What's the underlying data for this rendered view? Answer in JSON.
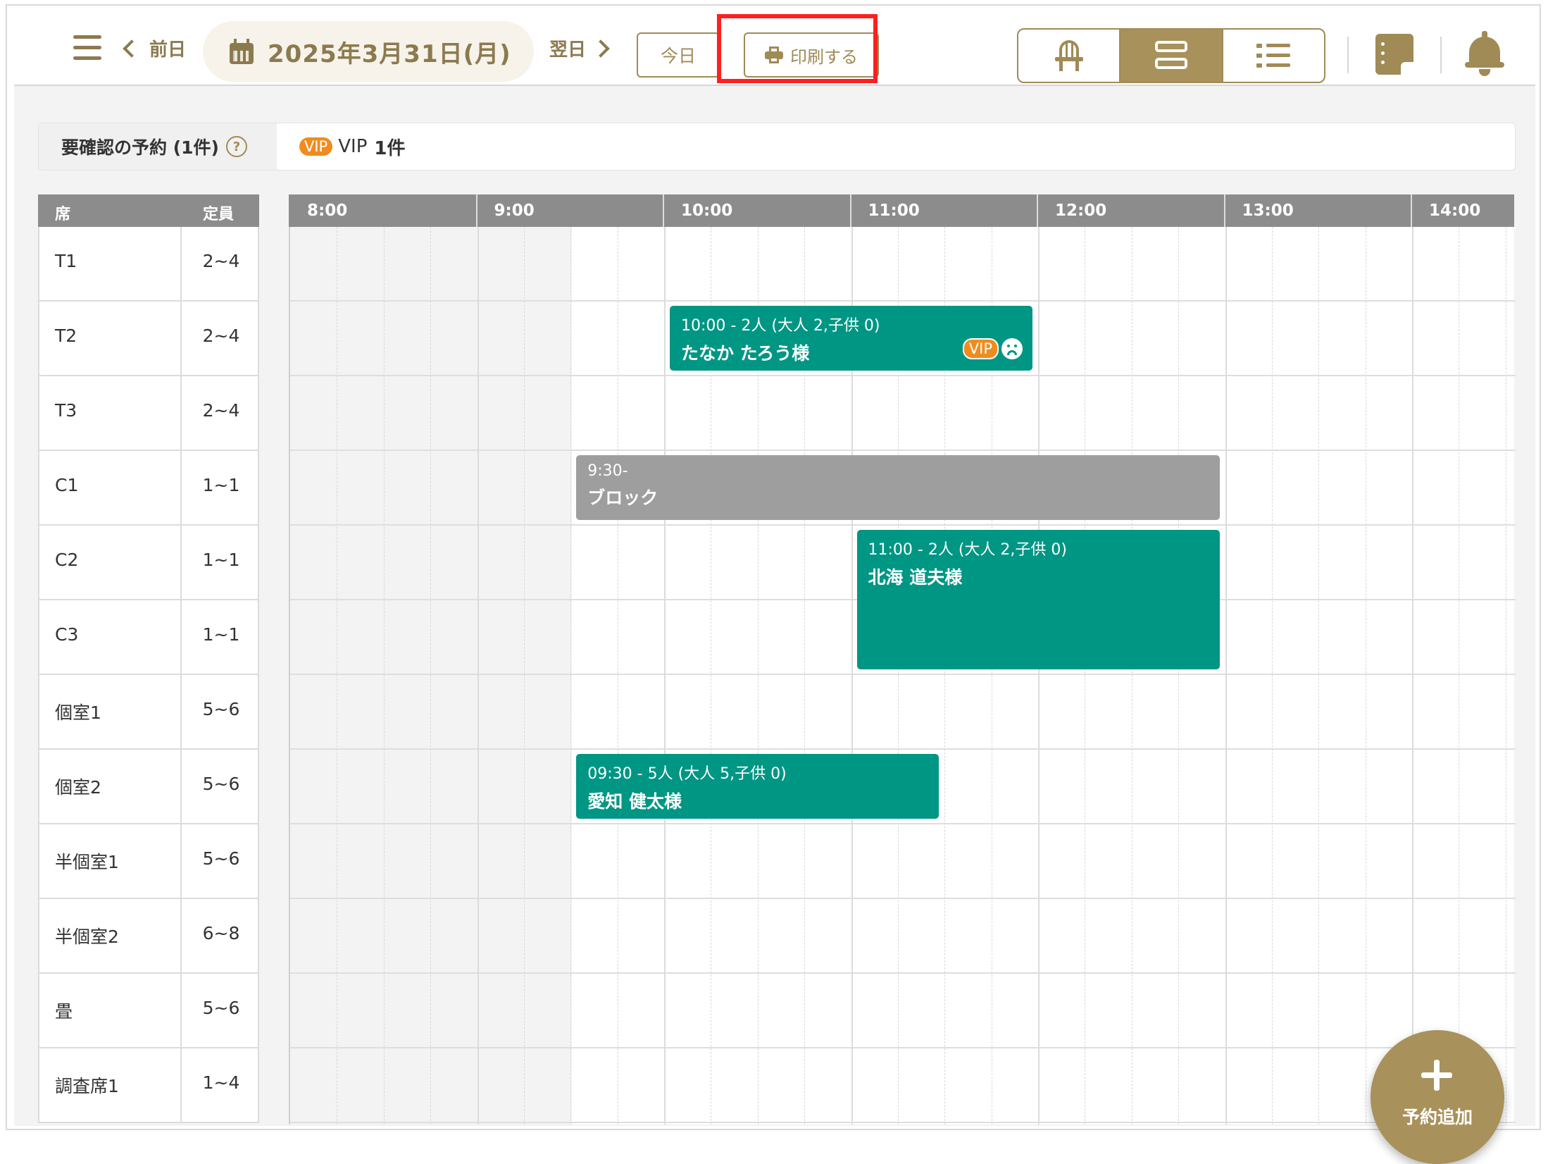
{
  "header": {
    "prev_label": "前日",
    "date": "2025年3月31日(月)",
    "next_label": "翌日",
    "today_label": "今日",
    "print_label": "印刷する",
    "view_modes": [
      "chair-icon",
      "rows-icon",
      "list-icon"
    ],
    "active_view": "rows-icon"
  },
  "notice": {
    "label": "要確認の予約 (1件)",
    "help": "?",
    "badge": "VIP",
    "type": "VIP",
    "count": "1件"
  },
  "seat_columns": {
    "seat": "席",
    "capacity": "定員"
  },
  "seats": [
    {
      "name": "T1",
      "capacity": "2~4"
    },
    {
      "name": "T2",
      "capacity": "2~4"
    },
    {
      "name": "T3",
      "capacity": "2~4"
    },
    {
      "name": "C1",
      "capacity": "1~1"
    },
    {
      "name": "C2",
      "capacity": "1~1"
    },
    {
      "name": "C3",
      "capacity": "1~1"
    },
    {
      "name": "個室1",
      "capacity": "5~6"
    },
    {
      "name": "個室2",
      "capacity": "5~6"
    },
    {
      "name": "半個室1",
      "capacity": "5~6"
    },
    {
      "name": "半個室2",
      "capacity": "6~8"
    },
    {
      "name": "畳",
      "capacity": "5~6"
    },
    {
      "name": "調査席1",
      "capacity": "1~4"
    }
  ],
  "times": [
    "8:00",
    "9:00",
    "10:00",
    "11:00",
    "12:00",
    "13:00",
    "14:00"
  ],
  "reservations": [
    {
      "time": "10:00 - 2人 (大人 2,子供 0)",
      "name": "たなか たろう様",
      "badge": "VIP",
      "mood": "sad-face-icon",
      "color": "#009684"
    },
    {
      "time": "9:30-",
      "name": "ブロック",
      "color": "#9e9e9e"
    },
    {
      "time": "11:00 - 2人 (大人 2,子供 0)",
      "name": "北海 道夫様",
      "color": "#009684"
    },
    {
      "time": "09:30 - 5人 (大人 5,子供 0)",
      "name": "愛知 健太様",
      "color": "#009684"
    }
  ],
  "fab": {
    "label": "予約追加"
  },
  "colors": {
    "accent": "#a8915a",
    "reservation": "#009684",
    "block": "#9e9e9e",
    "vip": "#f08c1e",
    "highlight": "#ff1f1f"
  }
}
